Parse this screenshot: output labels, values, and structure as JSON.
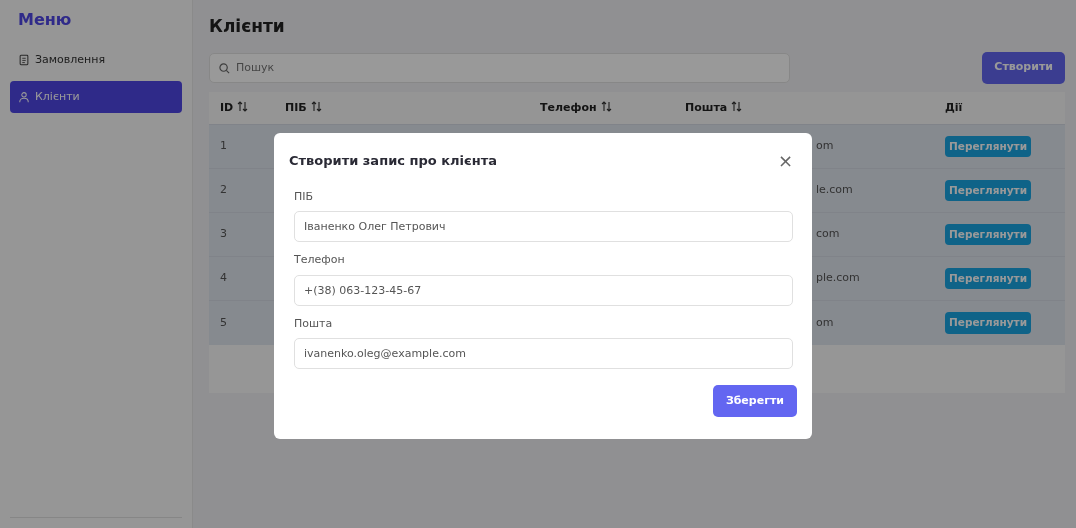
{
  "sidebar": {
    "title": "Меню",
    "items": [
      {
        "label": "Замовлення",
        "selected": false
      },
      {
        "label": "Клієнти",
        "selected": true
      }
    ]
  },
  "page": {
    "title": "Клієнти",
    "search": {
      "placeholder": "Пошук"
    },
    "create_button": "Створити"
  },
  "table": {
    "columns": [
      {
        "label": "ID",
        "sortable": true
      },
      {
        "label": "ПІБ",
        "sortable": true
      },
      {
        "label": "Телефон",
        "sortable": true
      },
      {
        "label": "Пошта",
        "sortable": true
      },
      {
        "label": "Дії",
        "sortable": false
      }
    ],
    "rows": [
      {
        "id": "1",
        "email": "om",
        "action": "Переглянути"
      },
      {
        "id": "2",
        "email": "le.com",
        "action": "Переглянути"
      },
      {
        "id": "3",
        "email": "com",
        "action": "Переглянути"
      },
      {
        "id": "4",
        "email": "ple.com",
        "action": "Переглянути"
      },
      {
        "id": "5",
        "email": "om",
        "action": "Переглянути"
      }
    ]
  },
  "modal": {
    "title": "Створити запис про клієнта",
    "close": "×",
    "fields": [
      {
        "label": "ПІБ",
        "value": "Іваненко Олег Петрович"
      },
      {
        "label": "Телефон",
        "value": "+(38) 063-123-45-67"
      },
      {
        "label": "Пошта",
        "value": "ivanenko.oleg@example.com"
      }
    ],
    "save_button": "Зберегти"
  }
}
